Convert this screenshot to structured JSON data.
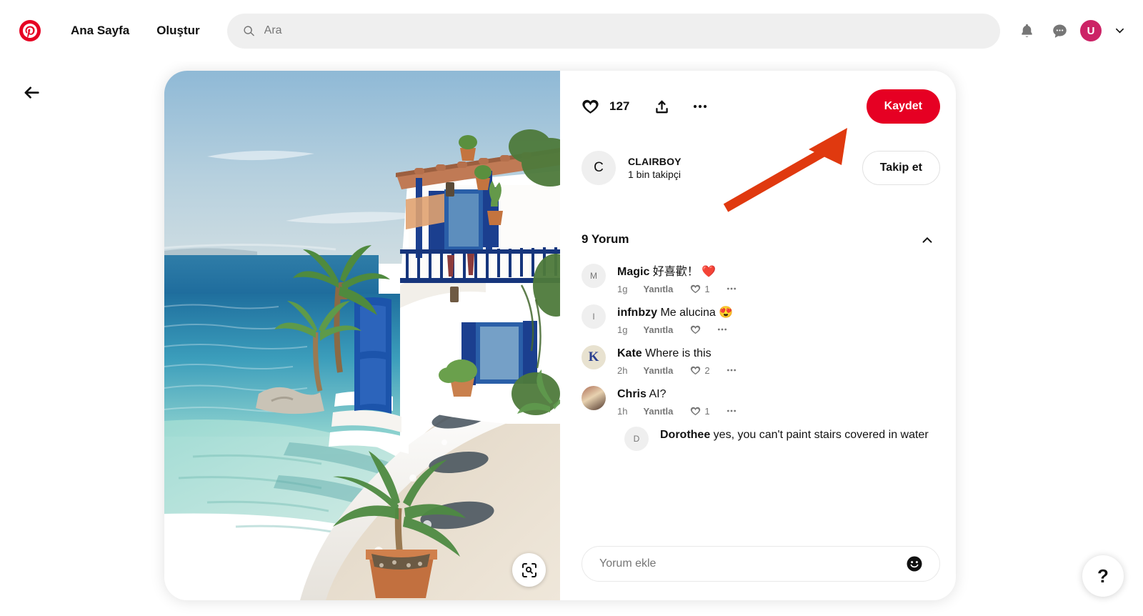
{
  "header": {
    "logo_icon": "pinterest-logo-icon",
    "nav": {
      "home": "Ana Sayfa",
      "create": "Oluştur"
    },
    "search": {
      "placeholder": "Ara",
      "value": "",
      "icon": "search-icon"
    },
    "icons": {
      "notifications": "bell-icon",
      "messages": "message-bubble-icon",
      "chevron": "chevron-down-icon"
    },
    "avatar_initial": "U",
    "avatar_color": "#cc2366"
  },
  "back_button": {
    "icon": "arrow-left-icon"
  },
  "pin": {
    "image_alt": "Mediterranean white villa with blue shutters beside turquoise sea with sand path and stepping stones",
    "visual_search_icon": "visual-search-icon",
    "actions": {
      "like_icon": "heart-icon",
      "like_count": "127",
      "share_icon": "share-upload-icon",
      "more_icon": "more-horizontal-icon",
      "save_label": "Kaydet",
      "save_color": "#e60023"
    },
    "creator": {
      "avatar_initial": "C",
      "name": "CLAIRBOY",
      "followers": "1 bin takipçi",
      "follow_label": "Takip et"
    }
  },
  "comments": {
    "heading": "9 Yorum",
    "collapse_icon": "chevron-up-icon",
    "items": [
      {
        "avatar_initial": "M",
        "avatar_style": "initial",
        "name": "Magic",
        "text": "好喜歡！ ❤️",
        "time": "1g",
        "reply_label": "Yanıtla",
        "like_count": "1",
        "is_reply": false
      },
      {
        "avatar_initial": "I",
        "avatar_style": "initial",
        "name": "infnbzy",
        "text": "Me alucina 😍",
        "time": "1g",
        "reply_label": "Yanıtla",
        "like_count": "",
        "is_reply": false
      },
      {
        "avatar_initial": "K",
        "avatar_style": "kate",
        "name": "Kate",
        "text": "Where is this",
        "time": "2h",
        "reply_label": "Yanıtla",
        "like_count": "2",
        "is_reply": false
      },
      {
        "avatar_initial": "",
        "avatar_style": "chris",
        "name": "Chris",
        "text": "AI?",
        "time": "1h",
        "reply_label": "Yanıtla",
        "like_count": "1",
        "is_reply": false
      },
      {
        "avatar_initial": "D",
        "avatar_style": "initial",
        "name": "Dorothee",
        "text": "yes, you can't paint stairs covered in water",
        "time": "",
        "reply_label": "",
        "like_count": "",
        "is_reply": true
      }
    ],
    "input": {
      "placeholder": "Yorum ekle",
      "value": "",
      "emoji_icon": "smiley-face-icon"
    }
  },
  "annotation": {
    "type": "arrow",
    "color": "#e0390f",
    "points_to": "Kaydet"
  },
  "help_button": {
    "label": "?"
  }
}
